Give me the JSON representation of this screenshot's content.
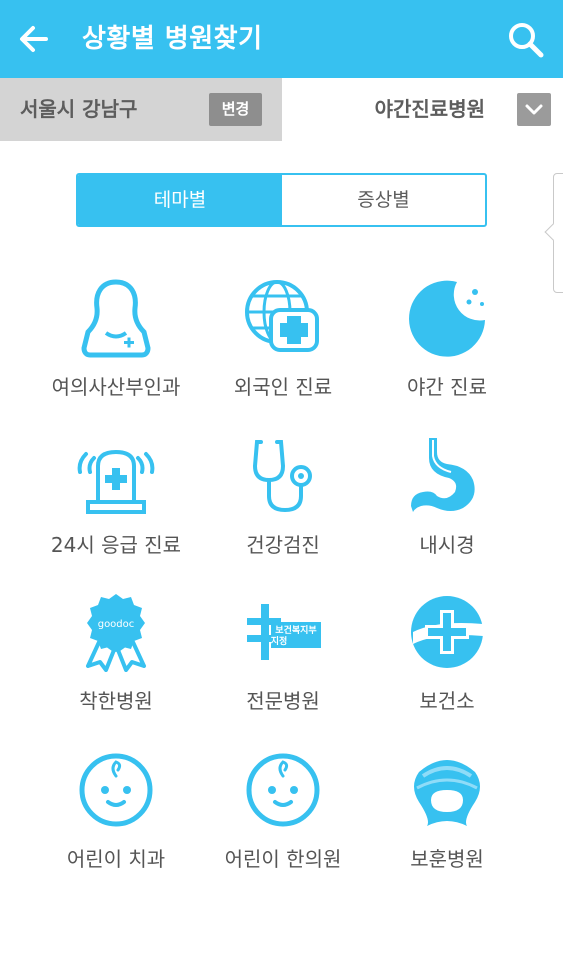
{
  "appbar": {
    "title": "상황별 병원찾기",
    "back_icon": "arrow-left-icon",
    "search_icon": "search-icon"
  },
  "filter": {
    "region": "서울시 강남구",
    "change_label": "변경",
    "type": "야간진료병원",
    "dropdown_icon": "chevron-down-icon"
  },
  "tabs": {
    "active": "테마별",
    "inactive": "증상별"
  },
  "colors": {
    "accent": "#37c1f0",
    "gray_bar": "#d4d4d4",
    "button_gray": "#8e8e8e",
    "text": "#555555"
  },
  "categories": [
    {
      "label": "여의사산부인과",
      "icon": "female-doctor-icon"
    },
    {
      "label": "외국인 진료",
      "icon": "globe-medical-icon"
    },
    {
      "label": "야간 진료",
      "icon": "moon-icon"
    },
    {
      "label": "24시 응급 진료",
      "icon": "emergency-siren-icon"
    },
    {
      "label": "건강검진",
      "icon": "stethoscope-icon"
    },
    {
      "label": "내시경",
      "icon": "stomach-icon"
    },
    {
      "label": "착한병원",
      "icon": "award-badge-icon",
      "badge_text": "goodoc"
    },
    {
      "label": "전문병원",
      "icon": "specialty-hospital-icon",
      "badge_text": "보건복지부 지정"
    },
    {
      "label": "보건소",
      "icon": "public-health-center-icon"
    },
    {
      "label": "어린이 치과",
      "icon": "baby-face-icon"
    },
    {
      "label": "어린이 한의원",
      "icon": "baby-face-icon"
    },
    {
      "label": "보훈병원",
      "icon": "veterans-hospital-icon"
    }
  ]
}
